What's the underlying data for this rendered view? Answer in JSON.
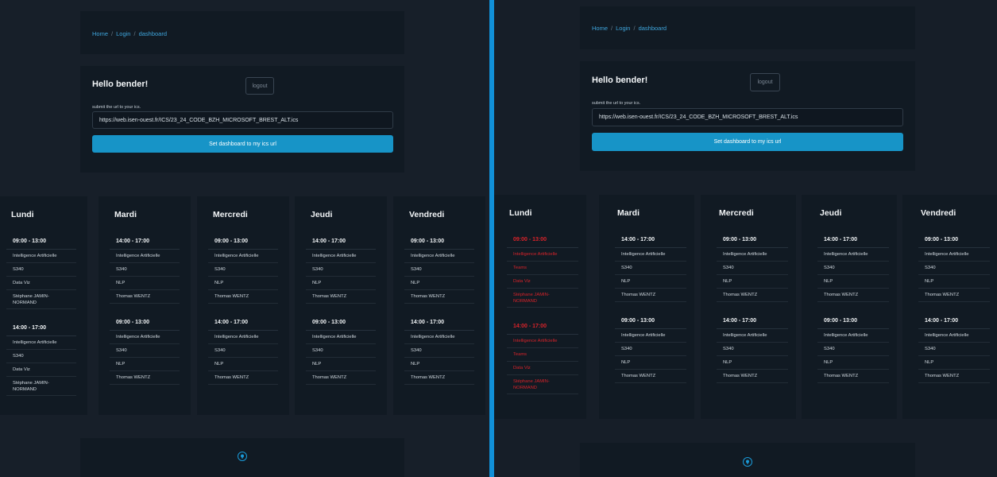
{
  "breadcrumb": [
    "Home",
    "Login",
    "dashboard"
  ],
  "breadcrumb_separator": "/",
  "greeting": "Hello bender!",
  "logout_label": "logout",
  "submit_label": "submit the url to your ics.",
  "ics_url_value": "https://web.isen-ouest.fr/ICS/23_24_CODE_BZH_MICROSOFT_BREST_ALT.ics",
  "set_button_label": "Set dashboard to my ics url",
  "footer_icon": "brand-logo-icon",
  "colors": {
    "accent": "#1794c7",
    "link": "#3fa6dd",
    "alert": "#d8232a",
    "divider": "#1190d8"
  },
  "days": [
    {
      "name": "Lundi",
      "events": [
        {
          "time": "09:00 - 13:00",
          "course": "Intelligence Artificielle",
          "room": "S340",
          "group": "Data Viz",
          "teacher": "Stéphane JAMIN-NORMAND"
        },
        {
          "time": "14:00 - 17:00",
          "course": "Intelligence Artificielle",
          "room": "S340",
          "group": "Data Viz",
          "teacher": "Stéphane JAMIN-NORMAND"
        }
      ]
    },
    {
      "name": "Mardi",
      "events": [
        {
          "time": "14:00 - 17:00",
          "course": "Intelligence Artificielle",
          "room": "S340",
          "group": "NLP",
          "teacher": "Thomas WENTZ"
        },
        {
          "time": "09:00 - 13:00",
          "course": "Intelligence Artificielle",
          "room": "S340",
          "group": "NLP",
          "teacher": "Thomas WENTZ"
        }
      ]
    },
    {
      "name": "Mercredi",
      "events": [
        {
          "time": "09:00 - 13:00",
          "course": "Intelligence Artificielle",
          "room": "S340",
          "group": "NLP",
          "teacher": "Thomas WENTZ"
        },
        {
          "time": "14:00 - 17:00",
          "course": "Intelligence Artificielle",
          "room": "S340",
          "group": "NLP",
          "teacher": "Thomas WENTZ"
        }
      ]
    },
    {
      "name": "Jeudi",
      "events": [
        {
          "time": "14:00 - 17:00",
          "course": "Intelligence Artificielle",
          "room": "S340",
          "group": "NLP",
          "teacher": "Thomas WENTZ"
        },
        {
          "time": "09:00 - 13:00",
          "course": "Intelligence Artificielle",
          "room": "S340",
          "group": "NLP",
          "teacher": "Thomas WENTZ"
        }
      ]
    },
    {
      "name": "Vendredi",
      "events": [
        {
          "time": "09:00 - 13:00",
          "course": "Intelligence Artificielle",
          "room": "S340",
          "group": "NLP",
          "teacher": "Thomas WENTZ"
        },
        {
          "time": "14:00 - 17:00",
          "course": "Intelligence Artificielle",
          "room": "S340",
          "group": "NLP",
          "teacher": "Thomas WENTZ"
        }
      ]
    }
  ],
  "right_days": [
    {
      "name": "Lundi",
      "events": [
        {
          "time": "09:00 - 13:00",
          "course": "Intelligence Artificielle",
          "room": "Teams",
          "group": "Data Viz",
          "teacher": "Stéphane JAMIN-NORMAND",
          "highlight": true
        },
        {
          "time": "14:00 - 17:00",
          "course": "Intelligence Artificielle",
          "room": "Teams",
          "group": "Data Viz",
          "teacher": "Stéphane JAMIN-NORMAND",
          "highlight": true
        }
      ]
    },
    {
      "name": "Mardi",
      "events": [
        {
          "time": "14:00 - 17:00",
          "course": "Intelligence Artificielle",
          "room": "S340",
          "group": "NLP",
          "teacher": "Thomas WENTZ"
        },
        {
          "time": "09:00 - 13:00",
          "course": "Intelligence Artificielle",
          "room": "S340",
          "group": "NLP",
          "teacher": "Thomas WENTZ"
        }
      ]
    },
    {
      "name": "Mercredi",
      "events": [
        {
          "time": "09:00 - 13:00",
          "course": "Intelligence Artificielle",
          "room": "S340",
          "group": "NLP",
          "teacher": "Thomas WENTZ"
        },
        {
          "time": "14:00 - 17:00",
          "course": "Intelligence Artificielle",
          "room": "S340",
          "group": "NLP",
          "teacher": "Thomas WENTZ"
        }
      ]
    },
    {
      "name": "Jeudi",
      "events": [
        {
          "time": "14:00 - 17:00",
          "course": "Intelligence Artificielle",
          "room": "S340",
          "group": "NLP",
          "teacher": "Thomas WENTZ"
        },
        {
          "time": "09:00 - 13:00",
          "course": "Intelligence Artificielle",
          "room": "S340",
          "group": "NLP",
          "teacher": "Thomas WENTZ"
        }
      ]
    },
    {
      "name": "Vendredi",
      "events": [
        {
          "time": "09:00 - 13:00",
          "course": "Intelligence Artificielle",
          "room": "S340",
          "group": "NLP",
          "teacher": "Thomas WENTZ"
        },
        {
          "time": "14:00 - 17:00",
          "course": "Intelligence Artificielle",
          "room": "S340",
          "group": "NLP",
          "teacher": "Thomas WENTZ"
        }
      ]
    }
  ]
}
